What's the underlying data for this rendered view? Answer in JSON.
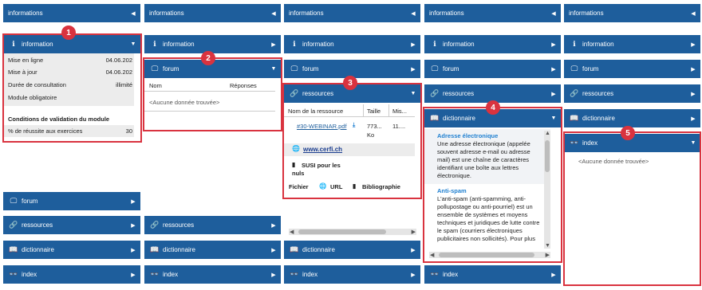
{
  "common": {
    "informations": "informations",
    "information": "information",
    "forum": "forum",
    "ressources": "ressources",
    "dictionnaire": "dictionnaire",
    "index": "index",
    "empty": "<Aucune donnée trouvée>"
  },
  "info_panel": {
    "rows": [
      {
        "label": "Mise en ligne",
        "value": "04.06.202"
      },
      {
        "label": "Mise à jour",
        "value": "04.06.202"
      },
      {
        "label": "Durée de consultation",
        "value": "illimité"
      },
      {
        "label": "Module obligatoire",
        "value": ""
      }
    ],
    "conditions_title": "Conditions de validation du module",
    "success_label": "% de réussite aux exercices",
    "success_value": "30"
  },
  "forum_panel": {
    "col_name": "Nom",
    "col_replies": "Réponses"
  },
  "resources_panel": {
    "col_name": "Nom de la ressource",
    "col_size": "Taille",
    "col_mis": "Mis...",
    "file_name": "#30-WEBINAR.pdf",
    "file_size": "773...",
    "file_unit": "Ko",
    "file_date": "11....",
    "link": "www.cerfi.ch",
    "book_line1": "SUSI pour les",
    "book_line2": "nuls",
    "filter_fichier": "Fichier",
    "filter_url": "URL",
    "filter_biblio": "Bibliographie"
  },
  "dictionary_panel": {
    "term1": "Adresse électronique",
    "def1": "Une adresse électronique (appelée souvent adresse e-mail ou adresse mail) est une chaîne de caractères identifiant une boîte aux lettres électronique.",
    "term2": "Anti-spam",
    "def2": "L'anti-spam (anti-spamming, anti-pollupostage ou anti-pourriel) est un ensemble de systèmes et moyens techniques et juridiques de lutte contre le spam (courriers électroniques publicitaires non sollicités). Pour plus"
  },
  "callouts": [
    "1",
    "2",
    "3",
    "4",
    "5"
  ],
  "colors": {
    "header": "#1e5e9c",
    "callout": "#d9333f"
  }
}
